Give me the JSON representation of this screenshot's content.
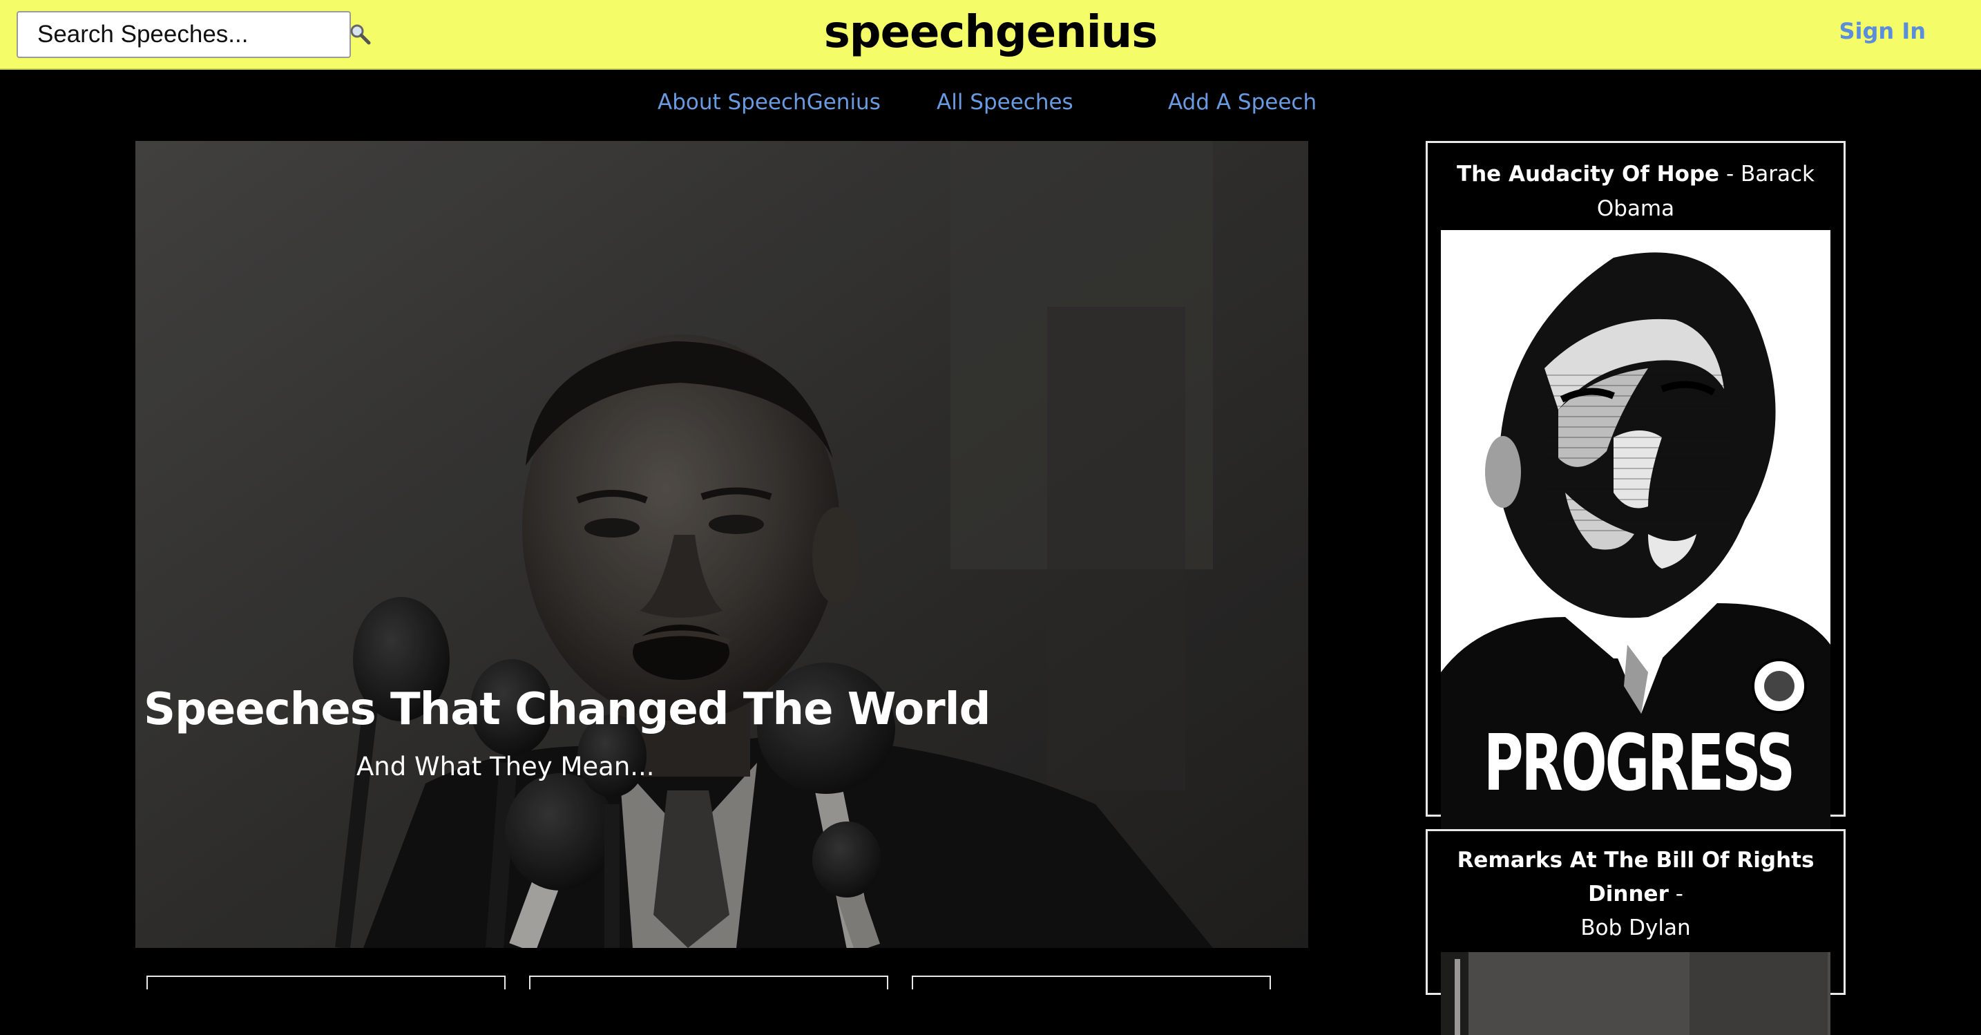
{
  "header": {
    "search_placeholder": "Search Speeches...",
    "brand": "speechgenius",
    "sign_in": "Sign In"
  },
  "nav": {
    "about": "About SpeechGenius",
    "all": "All Speeches",
    "add": "Add A Speech"
  },
  "hero": {
    "title": "Speeches That Changed The World",
    "subtitle": "And What They Mean..."
  },
  "sidebar": {
    "cards": [
      {
        "title": "The Audacity Of Hope",
        "separator": " - ",
        "speaker": "Barack Obama",
        "poster_text": "PROGRESS"
      },
      {
        "title": "Remarks At The Bill Of Rights Dinner",
        "separator": " - ",
        "speaker": "Bob Dylan"
      }
    ]
  },
  "colors": {
    "topbar_bg": "#f4fd68",
    "link_blue": "#6a9be0",
    "page_bg": "#000000"
  },
  "icons": {
    "search": "search-icon"
  }
}
